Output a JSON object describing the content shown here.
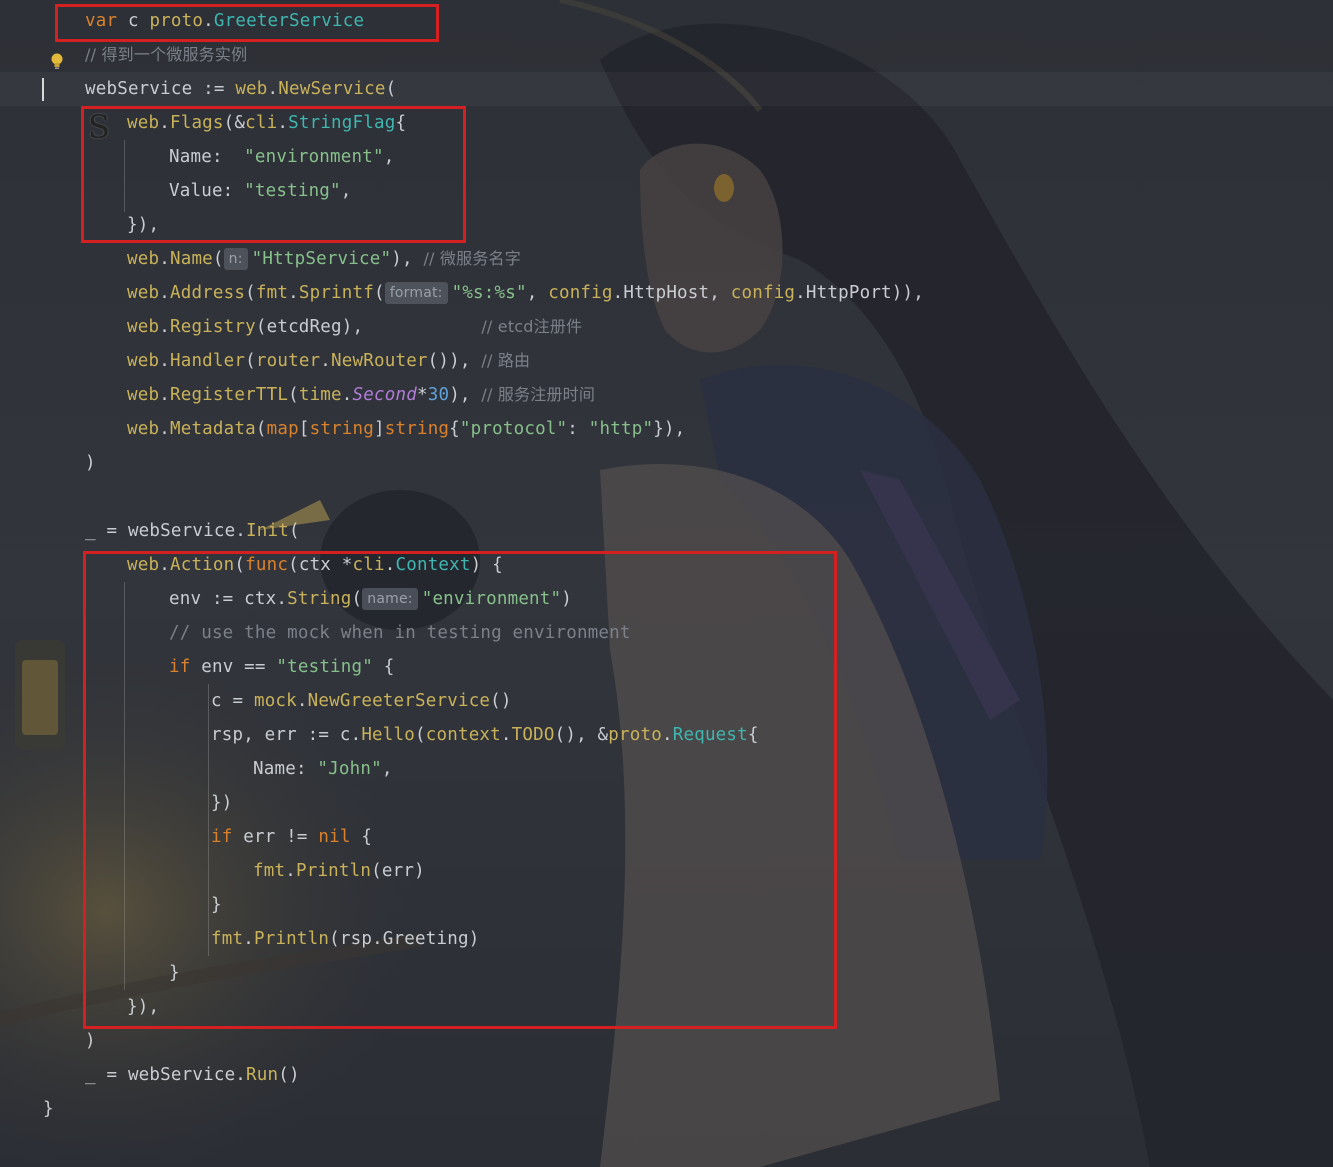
{
  "editor": {
    "language": "go",
    "lines": [
      [
        [
          "kw",
          "var"
        ],
        [
          "id",
          " c "
        ],
        [
          "pkg",
          "proto"
        ],
        [
          "id",
          "."
        ],
        [
          "ty",
          "GreeterService"
        ]
      ],
      [
        [
          "cm",
          "// 得到一个微服务实例"
        ]
      ],
      [
        [
          "id",
          "webService := "
        ],
        [
          "pkg",
          "web"
        ],
        [
          "id",
          "."
        ],
        [
          "fn",
          "NewService"
        ],
        [
          "id",
          "("
        ]
      ],
      [
        [
          "pkg",
          "web"
        ],
        [
          "id",
          "."
        ],
        [
          "fn",
          "Flags"
        ],
        [
          "id",
          "(&"
        ],
        [
          "pkg",
          "cli"
        ],
        [
          "id",
          "."
        ],
        [
          "ty",
          "StringFlag"
        ],
        [
          "id",
          "{"
        ]
      ],
      [
        [
          "id",
          "Name:  "
        ],
        [
          "str",
          "\"environment\""
        ],
        [
          "id",
          ","
        ]
      ],
      [
        [
          "id",
          "Value: "
        ],
        [
          "str",
          "\"testing\""
        ],
        [
          "id",
          ","
        ]
      ],
      [
        [
          "id",
          "}),"
        ]
      ],
      [
        [
          "pkg",
          "web"
        ],
        [
          "id",
          "."
        ],
        [
          "fn",
          "Name"
        ],
        [
          "id",
          "("
        ],
        [
          "hint",
          "n:"
        ],
        [
          "str",
          "\"HttpService\""
        ],
        [
          "id",
          "), "
        ],
        [
          "cm",
          "// 微服务名字"
        ]
      ],
      [
        [
          "pkg",
          "web"
        ],
        [
          "id",
          "."
        ],
        [
          "fn",
          "Address"
        ],
        [
          "id",
          "("
        ],
        [
          "pkg",
          "fmt"
        ],
        [
          "id",
          "."
        ],
        [
          "fn",
          "Sprintf"
        ],
        [
          "id",
          "("
        ],
        [
          "hint",
          "format:"
        ],
        [
          "str",
          "\"%s:%s\""
        ],
        [
          "id",
          ", "
        ],
        [
          "pkg",
          "config"
        ],
        [
          "id",
          ".HttpHost, "
        ],
        [
          "pkg",
          "config"
        ],
        [
          "id",
          ".HttpPort)),"
        ]
      ],
      [
        [
          "pkg",
          "web"
        ],
        [
          "id",
          "."
        ],
        [
          "fn",
          "Registry"
        ],
        [
          "id",
          "(etcdReg),           "
        ],
        [
          "cm",
          "// etcd注册件"
        ]
      ],
      [
        [
          "pkg",
          "web"
        ],
        [
          "id",
          "."
        ],
        [
          "fn",
          "Handler"
        ],
        [
          "id",
          "("
        ],
        [
          "pkg",
          "router"
        ],
        [
          "id",
          "."
        ],
        [
          "fn",
          "NewRouter"
        ],
        [
          "id",
          "()), "
        ],
        [
          "cm",
          "// 路由"
        ]
      ],
      [
        [
          "pkg",
          "web"
        ],
        [
          "id",
          "."
        ],
        [
          "fn",
          "RegisterTTL"
        ],
        [
          "id",
          "("
        ],
        [
          "pkg",
          "time"
        ],
        [
          "id",
          "."
        ],
        [
          "it",
          "Second"
        ],
        [
          "id",
          "*"
        ],
        [
          "num",
          "30"
        ],
        [
          "id",
          "), "
        ],
        [
          "cm",
          "// 服务注册时间"
        ]
      ],
      [
        [
          "pkg",
          "web"
        ],
        [
          "id",
          "."
        ],
        [
          "fn",
          "Metadata"
        ],
        [
          "id",
          "("
        ],
        [
          "kw",
          "map"
        ],
        [
          "id",
          "["
        ],
        [
          "kw",
          "string"
        ],
        [
          "id",
          "]"
        ],
        [
          "kw",
          "string"
        ],
        [
          "id",
          "{"
        ],
        [
          "str",
          "\"protocol\""
        ],
        [
          "id",
          ": "
        ],
        [
          "str",
          "\"http\""
        ],
        [
          "id",
          "}),"
        ]
      ],
      [
        [
          "id",
          ")"
        ]
      ],
      [
        [
          "id",
          ""
        ]
      ],
      [
        [
          "id",
          "_ = webService."
        ],
        [
          "fn",
          "Init"
        ],
        [
          "id",
          "("
        ]
      ],
      [
        [
          "pkg",
          "web"
        ],
        [
          "id",
          "."
        ],
        [
          "fn",
          "Action"
        ],
        [
          "id",
          "("
        ],
        [
          "kw",
          "func"
        ],
        [
          "id",
          "(ctx *"
        ],
        [
          "pkg",
          "cli"
        ],
        [
          "id",
          "."
        ],
        [
          "ty",
          "Context"
        ],
        [
          "id",
          ") {"
        ]
      ],
      [
        [
          "id",
          "env := ctx."
        ],
        [
          "fn",
          "String"
        ],
        [
          "id",
          "("
        ],
        [
          "hint",
          "name:"
        ],
        [
          "str",
          "\"environment\""
        ],
        [
          "id",
          ")"
        ]
      ],
      [
        [
          "cm-mono",
          "// use the mock when in testing environment"
        ]
      ],
      [
        [
          "kw",
          "if"
        ],
        [
          "id",
          " env == "
        ],
        [
          "str",
          "\"testing\""
        ],
        [
          "id",
          " {"
        ]
      ],
      [
        [
          "id",
          "c = "
        ],
        [
          "pkg",
          "mock"
        ],
        [
          "id",
          "."
        ],
        [
          "fn",
          "NewGreeterService"
        ],
        [
          "id",
          "()"
        ]
      ],
      [
        [
          "id",
          "rsp, err := c."
        ],
        [
          "fn",
          "Hello"
        ],
        [
          "id",
          "("
        ],
        [
          "pkg",
          "context"
        ],
        [
          "id",
          "."
        ],
        [
          "fn",
          "TODO"
        ],
        [
          "id",
          "(), &"
        ],
        [
          "pkg",
          "proto"
        ],
        [
          "id",
          "."
        ],
        [
          "ty",
          "Request"
        ],
        [
          "id",
          "{"
        ]
      ],
      [
        [
          "id",
          "Name: "
        ],
        [
          "str",
          "\"John\""
        ],
        [
          "id",
          ","
        ]
      ],
      [
        [
          "id",
          "})"
        ]
      ],
      [
        [
          "kw",
          "if"
        ],
        [
          "id",
          " err != "
        ],
        [
          "kw",
          "nil"
        ],
        [
          "id",
          " {"
        ]
      ],
      [
        [
          "pkg",
          "fmt"
        ],
        [
          "id",
          "."
        ],
        [
          "fn",
          "Println"
        ],
        [
          "id",
          "(err)"
        ]
      ],
      [
        [
          "id",
          "}"
        ]
      ],
      [
        [
          "pkg",
          "fmt"
        ],
        [
          "id",
          "."
        ],
        [
          "fn",
          "Println"
        ],
        [
          "id",
          "(rsp.Greeting)"
        ]
      ],
      [
        [
          "id",
          "}"
        ]
      ],
      [
        [
          "id",
          "}),"
        ]
      ],
      [
        [
          "id",
          ")"
        ]
      ],
      [
        [
          "id",
          "_ = webService."
        ],
        [
          "fn",
          "Run"
        ],
        [
          "id",
          "()"
        ]
      ],
      [
        [
          "id",
          "}"
        ]
      ]
    ]
  },
  "colors": {
    "keyword": "#d9822b",
    "function": "#c9b25a",
    "type": "#3fb6b0",
    "string": "#87c08b",
    "comment": "#7b8089",
    "number": "#5fa0d8",
    "highlight_box": "#d42020"
  },
  "icons": [
    "lightbulb-icon",
    "plugin-s-icon"
  ]
}
